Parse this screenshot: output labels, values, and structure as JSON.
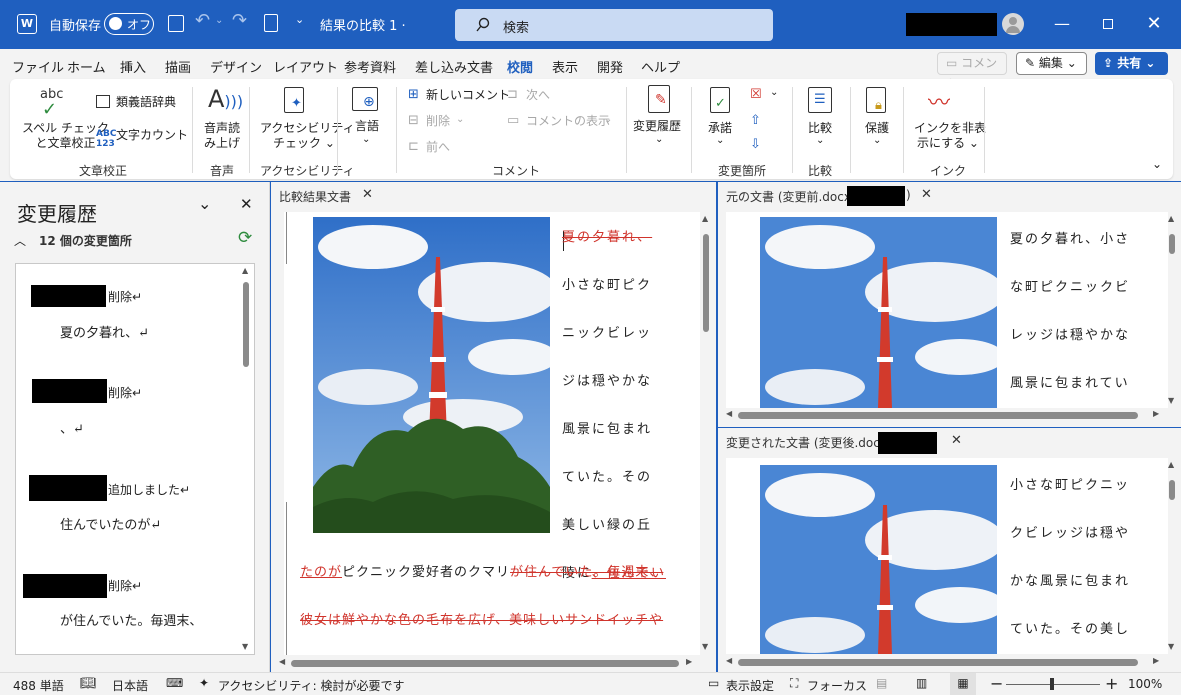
{
  "titlebar": {
    "autosave_label": "自動保存",
    "autosave_state": "オフ",
    "title": "結果の比較 1  ·",
    "search_placeholder": "検索"
  },
  "menu": {
    "tabs": [
      "ファイル",
      "ホーム",
      "挿入",
      "描画",
      "デザイン",
      "レイアウト",
      "参考資料",
      "差し込み文書",
      "校閲",
      "表示",
      "開発",
      "ヘルプ"
    ],
    "active_tab": "校閲",
    "comment_button": "コメント",
    "edit_button": "編集",
    "share_button": "共有"
  },
  "ribbon": {
    "spellcheck": "スペル チェック\nと文章校正",
    "abc": "abc",
    "thesaurus": "類義語辞典",
    "wordcount": "文字カウント",
    "group_proofing": "文章校正",
    "readaloud_1": "音声読",
    "readaloud_2": "み上げ",
    "group_speech": "音声",
    "accessibility_1": "アクセシビリティ",
    "accessibility_2": "チェック ⌄",
    "group_accessibility": "アクセシビリティ",
    "language": "言語",
    "new_comment": "新しいコメント",
    "delete": "削除",
    "previous": "前へ",
    "next": "次へ",
    "show_comments": "コメントの表示",
    "group_comments": "コメント",
    "track_changes": "変更履歴",
    "accept": "承諾",
    "group_changes": "変更箇所",
    "compare": "比較",
    "group_compare": "比較",
    "protect": "保護",
    "hide_ink_1": "インクを非表",
    "hide_ink_2": "示にする ⌄",
    "group_ink": "インク"
  },
  "revisions_panel": {
    "title": "変更履歴",
    "count": "12 個の変更箇所",
    "items": [
      {
        "action": "削除↵",
        "text": "夏の夕暮れ、↵"
      },
      {
        "action": "削除↵",
        "text": "、↵"
      },
      {
        "action": "追加しました↵",
        "text": "住んでいたのが↵"
      },
      {
        "action": "削除↵",
        "text": "が住んでいた。毎週末、"
      }
    ]
  },
  "compared_doc": {
    "tab": "比較結果文書",
    "col_del_top": "夏の夕暮れ、",
    "col_rest": "小さな町ピクニックビレッジは穏やかな風景に包まれていた。その美しい緑の丘陵に",
    "col_ins": "、住んでい",
    "line1_ins": "たのが",
    "line1_plain": "ピクニック愛好者のクマリ",
    "line1_del": "が住んでいた。毎週末、",
    "line2_del": "彼女は鮮やかな色の毛布を広げ、美味しいサンドイッチや"
  },
  "original_doc": {
    "tab": "元の文書 (変更前.docx -",
    "tab_end": ")",
    "text": "夏の夕暮れ、小さな町ピクニックビレッジは穏やかな風景に包まれていた。"
  },
  "revised_doc": {
    "tab": "変更された文書 (変更後.docx -",
    "text": "小さな町ピクニックビレッジは穏やかな風景に包まれていた。その美しい"
  },
  "statusbar": {
    "words": "488 単語",
    "language": "日本語",
    "accessibility": "アクセシビリティ: 検討が必要です",
    "display_settings": "表示設定",
    "focus": "フォーカス",
    "zoom": "100%"
  },
  "colors": {
    "accent": "#1f5fbf",
    "revision": "#d0342c"
  }
}
